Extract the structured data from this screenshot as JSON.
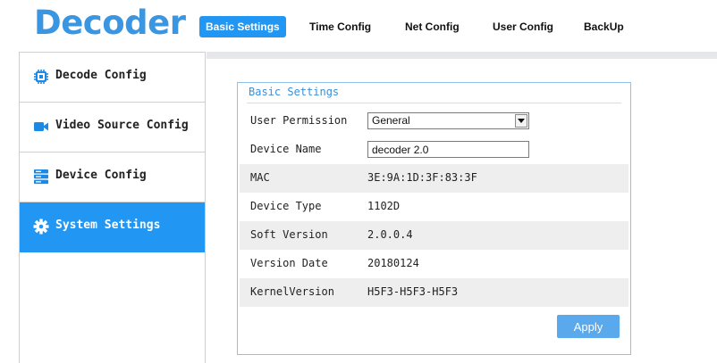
{
  "header": {
    "brand": "Decoder",
    "nav": [
      {
        "label": "Basic Settings",
        "active": true
      },
      {
        "label": "Time Config",
        "active": false
      },
      {
        "label": "Net Config",
        "active": false
      },
      {
        "label": "User Config",
        "active": false
      },
      {
        "label": "BackUp",
        "active": false
      }
    ]
  },
  "sidebar": {
    "items": [
      {
        "label": "Decode Config",
        "icon": "chip-icon",
        "active": false
      },
      {
        "label": "Video Source Config",
        "icon": "video-camera-icon",
        "active": false
      },
      {
        "label": "Device Config",
        "icon": "server-icon",
        "active": false
      },
      {
        "label": "System Settings",
        "icon": "gear-icon",
        "active": true
      }
    ]
  },
  "panel": {
    "title": "Basic Settings",
    "user_permission": {
      "label": "User Permission",
      "value": "General"
    },
    "device_name": {
      "label": "Device Name",
      "value": "decoder 2.0"
    },
    "mac": {
      "label": "MAC",
      "value": "3E:9A:1D:3F:83:3F"
    },
    "device_type": {
      "label": "Device Type",
      "value": "1102D"
    },
    "soft_version": {
      "label": "Soft Version",
      "value": "2.0.0.4"
    },
    "version_date": {
      "label": "Version Date",
      "value": "20180124"
    },
    "kernel_version": {
      "label": "KernelVersion",
      "value": "H5F3-H5F3-H5F3"
    },
    "apply_label": "Apply"
  },
  "colors": {
    "accent": "#2196f3",
    "brand": "#3a96e0",
    "button": "#5aa9ec",
    "panel_border": "#8fc1ea",
    "row_shade": "#eeeeee"
  }
}
